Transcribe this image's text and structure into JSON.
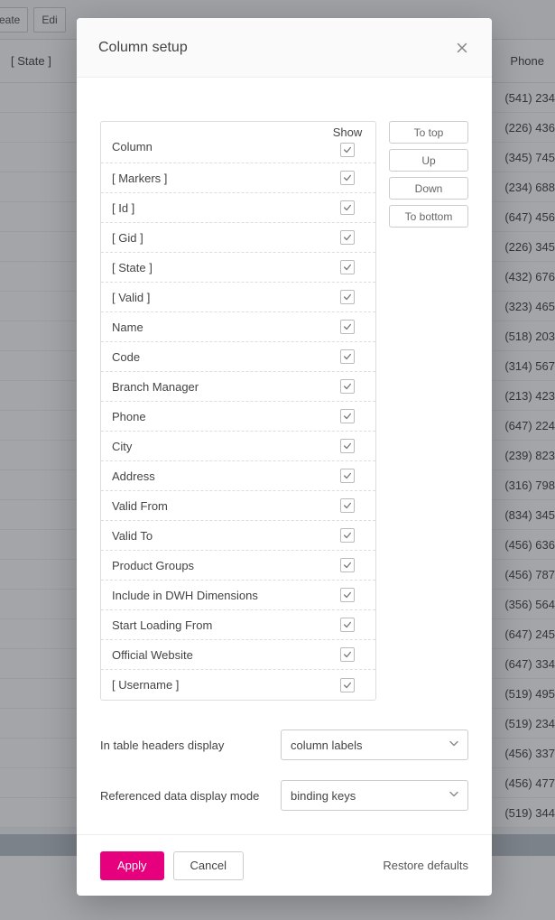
{
  "background": {
    "toolbar": {
      "create": "eate",
      "edit": "Edi"
    },
    "state_col": "[ State ]",
    "phone_col": "Phone",
    "phones": [
      "(541) 234",
      "(226) 436",
      "(345) 745",
      "(234) 688",
      "(647) 456",
      "(226) 345",
      "(432) 676",
      "(323) 465",
      "(518) 203",
      "(314) 567",
      "(213) 423",
      "(647) 224",
      "(239) 823",
      "(316) 798",
      "(834) 345",
      "(456) 636",
      "(456) 787",
      "(356) 564",
      "(647) 245",
      "(647) 334",
      "(519) 495",
      "(519) 234",
      "(456) 337",
      "(456) 477",
      "(519) 344"
    ]
  },
  "modal": {
    "title": "Column setup",
    "column_header": "Column",
    "show_header": "Show",
    "rows": [
      {
        "label": "[ Markers ]"
      },
      {
        "label": "[ Id ]"
      },
      {
        "label": "[ Gid ]"
      },
      {
        "label": "[ State ]"
      },
      {
        "label": "[ Valid ]"
      },
      {
        "label": "Name"
      },
      {
        "label": "Code"
      },
      {
        "label": "Branch Manager"
      },
      {
        "label": "Phone"
      },
      {
        "label": "City"
      },
      {
        "label": "Address"
      },
      {
        "label": "Valid From"
      },
      {
        "label": "Valid To"
      },
      {
        "label": "Product Groups"
      },
      {
        "label": "Include in DWH Dimensions"
      },
      {
        "label": "Start Loading From"
      },
      {
        "label": "Official Website"
      },
      {
        "label": "[ Username ]"
      }
    ],
    "move": {
      "to_top": "To top",
      "up": "Up",
      "down": "Down",
      "to_bottom": "To bottom"
    },
    "form": {
      "headers_label": "In table headers display",
      "headers_value": "column labels",
      "refmode_label": "Referenced data display mode",
      "refmode_value": "binding keys"
    },
    "footer": {
      "apply": "Apply",
      "cancel": "Cancel",
      "restore": "Restore defaults"
    }
  }
}
